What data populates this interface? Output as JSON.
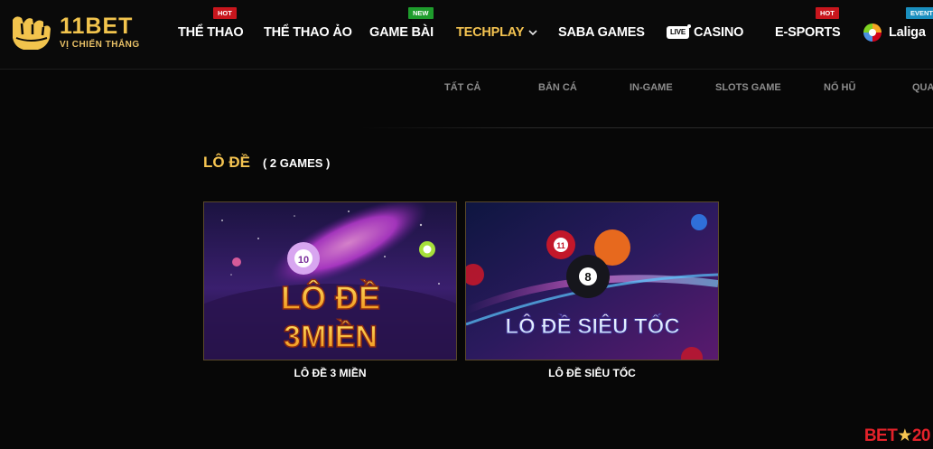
{
  "logo": {
    "brand": "11BET",
    "tagline": "VỊ CHIẾN THẮNG"
  },
  "nav": {
    "items": [
      {
        "label": "THỂ THAO",
        "badge": "HOT"
      },
      {
        "label": "THỂ THAO ẢO",
        "badge": ""
      },
      {
        "label": "GAME BÀI",
        "badge": "NEW"
      },
      {
        "label": "TECHPLAY",
        "badge": ""
      },
      {
        "label": "SABA GAMES",
        "badge": ""
      },
      {
        "label": "CASINO",
        "badge": "",
        "live": "LIVE"
      },
      {
        "label": "E-SPORTS",
        "badge": "HOT"
      },
      {
        "label": "Laliga",
        "badge": "EVENT"
      }
    ],
    "active": "TECHPLAY"
  },
  "subnav": {
    "items": [
      "TẤT CẢ",
      "BẮN CÁ",
      "IN-GAME",
      "SLOTS GAME",
      "NỔ HŨ",
      "QUAY"
    ]
  },
  "section": {
    "title": "LÔ ĐỀ",
    "count": "( 2 GAMES )"
  },
  "games": [
    {
      "name": "LÔ ĐỀ 3 MIỀN",
      "art_line1": "LÔ ĐỀ",
      "art_line2": "3MIỀN",
      "ball": "10"
    },
    {
      "name": "LÔ ĐỀ SIÊU TỐC",
      "art_text": "LÔ ĐỀ SIÊU TỐC",
      "ball_a": "11",
      "ball_b": "8"
    }
  ],
  "watermark": {
    "part1": "BET",
    "star": "★",
    "part2": "20"
  },
  "colors": {
    "accent": "#f5c451",
    "hot": "#c8161d",
    "new": "#1e9c2c",
    "event": "#1a8fbf",
    "background": "#070707"
  }
}
